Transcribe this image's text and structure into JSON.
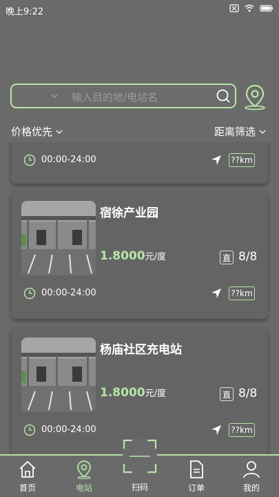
{
  "status": {
    "time": "晚上9:22"
  },
  "search": {
    "placeholder": "输入目的地/电站名"
  },
  "filters": {
    "sort_label": "价格优先",
    "distance_label": "距离筛选"
  },
  "stations": [
    {
      "name": "",
      "price": "",
      "unit": "",
      "direct": "",
      "available": "",
      "hours": "00:00-24:00",
      "distance": "??km"
    },
    {
      "name": "宿徐产业园",
      "price": "1.8000",
      "unit": "元/度",
      "direct": "直",
      "available": "8/8",
      "hours": "00:00-24:00",
      "distance": "??km"
    },
    {
      "name": "杨庙社区充电站",
      "price": "1.8000",
      "unit": "元/度",
      "direct": "直",
      "available": "8/8",
      "hours": "00:00-24:00",
      "distance": "??km"
    }
  ],
  "tabs": [
    {
      "label": "首页",
      "icon": "home-icon"
    },
    {
      "label": "电站",
      "icon": "location-pin-icon"
    },
    {
      "label": "扫码",
      "icon": "scan-icon"
    },
    {
      "label": "订单",
      "icon": "document-icon"
    },
    {
      "label": "我的",
      "icon": "user-icon"
    }
  ],
  "colors": {
    "accent": "#b7e5a8",
    "background": "#6a6a6a",
    "card": "#646464"
  }
}
